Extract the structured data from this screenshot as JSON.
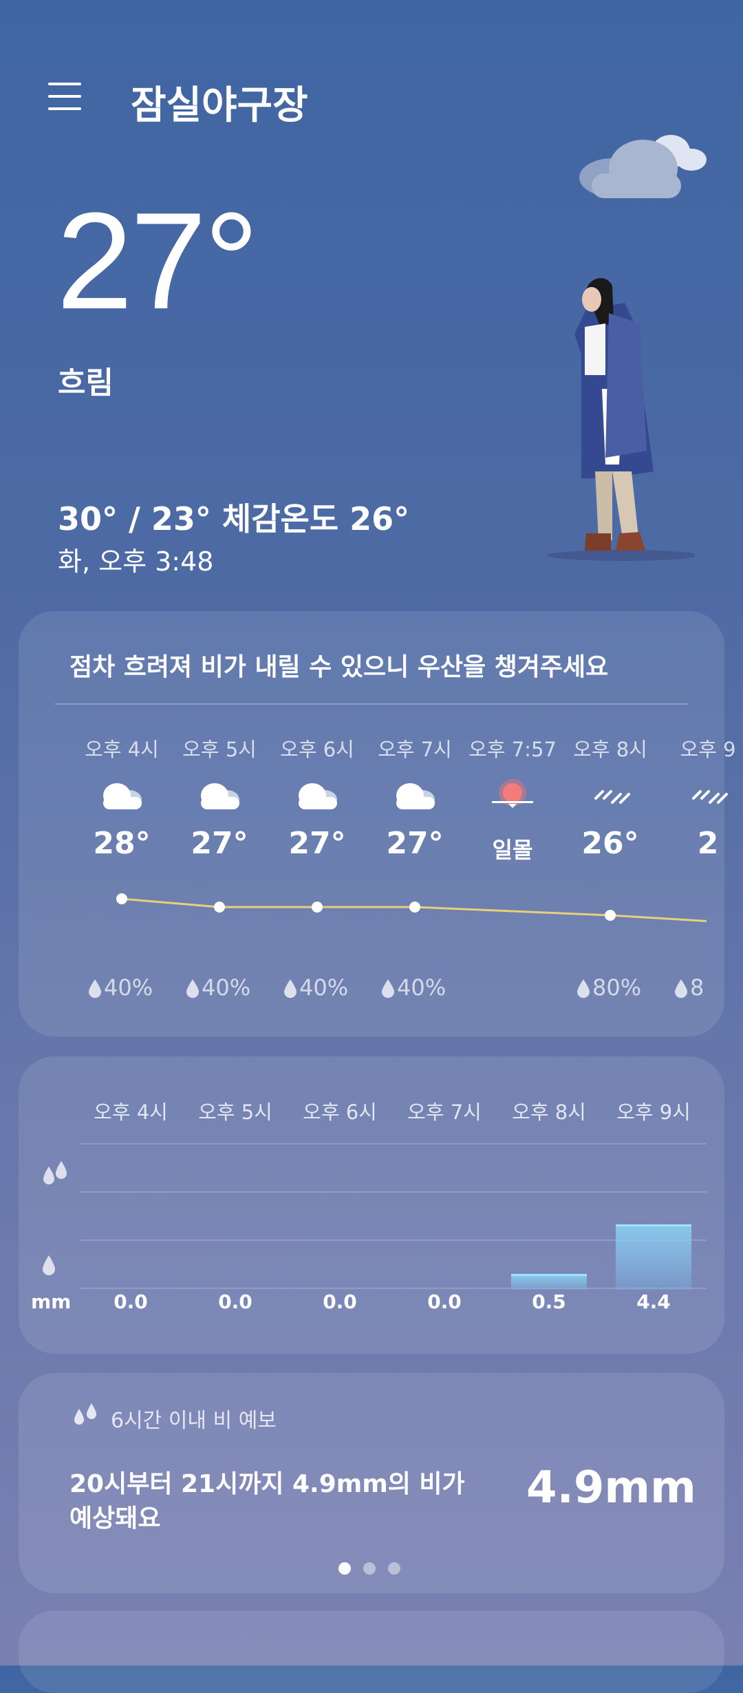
{
  "header": {
    "title": "잠실야구장",
    "menu_icon": "menu-icon"
  },
  "current": {
    "temperature": "27°",
    "condition": "흐림",
    "range": "30° / 23° 체감온도 26°",
    "datetime": "화, 오후 3:48"
  },
  "hourly": {
    "advice": "점차 흐려져 비가 내릴 수 있으니 우산을 챙겨주세요",
    "items": [
      {
        "time": "오후 4시",
        "icon": "cloudy-icon",
        "temp": "28°",
        "precip": "40%"
      },
      {
        "time": "오후 5시",
        "icon": "cloudy-icon",
        "temp": "27°",
        "precip": "40%"
      },
      {
        "time": "오후 6시",
        "icon": "cloudy-icon",
        "temp": "27°",
        "precip": "40%"
      },
      {
        "time": "오후 7시",
        "icon": "cloudy-icon",
        "temp": "27°",
        "precip": "40%"
      },
      {
        "time": "오후 7:57",
        "icon": "sunset-icon",
        "temp": "일몰",
        "precip": ""
      },
      {
        "time": "오후 8시",
        "icon": "rain-icon",
        "temp": "26°",
        "precip": "80%"
      },
      {
        "time": "오후 9",
        "icon": "rain-icon",
        "temp": "2",
        "precip": "8"
      }
    ]
  },
  "rain_chart": {
    "unit": "mm",
    "hours": [
      "오후 4시",
      "오후 5시",
      "오후 6시",
      "오후 7시",
      "오후 8시",
      "오후 9시"
    ],
    "values": [
      "0.0",
      "0.0",
      "0.0",
      "0.0",
      "0.5",
      "4.4"
    ]
  },
  "forecast": {
    "label": "6시간 이내 비 예보",
    "line1": "20시부터 21시까지 4.9mm의 비가",
    "line2": "예상돼요",
    "amount": "4.9mm",
    "pages": 3,
    "active_page": 1
  },
  "chart_data": [
    {
      "type": "line",
      "categories": [
        "오후 4시",
        "오후 5시",
        "오후 6시",
        "오후 7시",
        "오후 8시"
      ],
      "values": [
        28,
        27,
        27,
        27,
        26
      ]
    },
    {
      "type": "bar",
      "categories": [
        "오후 4시",
        "오후 5시",
        "오후 6시",
        "오후 7시",
        "오후 8시",
        "오후 9시"
      ],
      "values": [
        0.0,
        0.0,
        0.0,
        0.0,
        0.5,
        4.4
      ],
      "ylabel": "mm"
    }
  ]
}
